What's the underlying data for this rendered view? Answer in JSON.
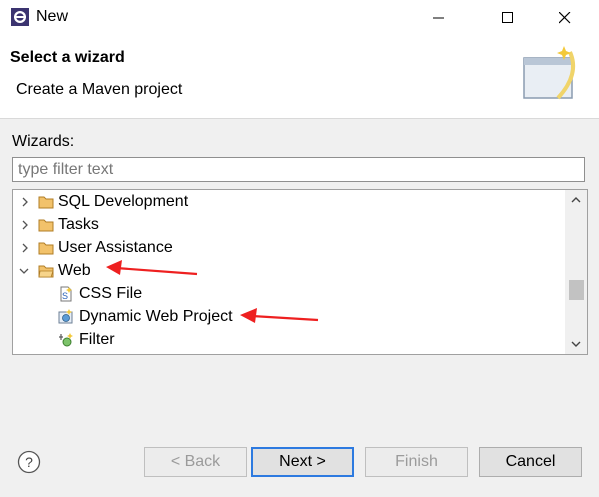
{
  "window": {
    "title": "New",
    "controls": [
      "minimize",
      "maximize",
      "close"
    ]
  },
  "header": {
    "heading": "Select a wizard",
    "subheading": "Create a Maven project"
  },
  "wizards_label": "Wizards:",
  "filter": {
    "placeholder": "type filter text",
    "value": ""
  },
  "tree": {
    "items": [
      {
        "label": "SQL Development",
        "type": "folder",
        "expanded": false,
        "level": 0
      },
      {
        "label": "Tasks",
        "type": "folder",
        "expanded": false,
        "level": 0
      },
      {
        "label": "User Assistance",
        "type": "folder",
        "expanded": false,
        "level": 0
      },
      {
        "label": "Web",
        "type": "folder",
        "expanded": true,
        "level": 0
      },
      {
        "label": "CSS File",
        "type": "wizard",
        "icon": "css-file-icon",
        "level": 1
      },
      {
        "label": "Dynamic Web Project",
        "type": "wizard",
        "icon": "dynamic-web-project-icon",
        "level": 1
      },
      {
        "label": "Filter",
        "type": "wizard",
        "icon": "filter-icon",
        "level": 1
      }
    ]
  },
  "buttons": {
    "back": "< Back",
    "next": "Next >",
    "finish": "Finish",
    "cancel": "Cancel"
  },
  "colors": {
    "annotation_arrow": "#ee2020",
    "folder": "#e8a33d",
    "default_button_border": "#2d7ae0"
  }
}
